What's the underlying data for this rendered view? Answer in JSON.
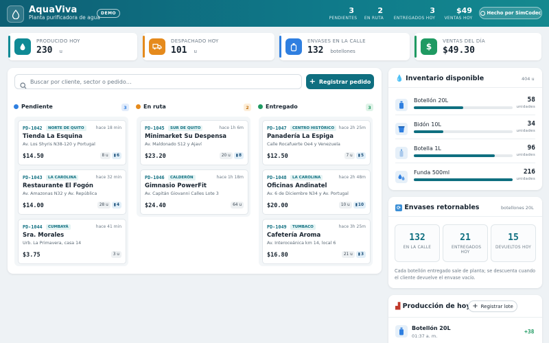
{
  "header": {
    "brand": "AquaViva",
    "subtitle": "Planta purificadora de agua",
    "demo": "DEMO",
    "stats": [
      {
        "value": "3",
        "label": "PENDIENTES"
      },
      {
        "value": "2",
        "label": "EN RUTA"
      },
      {
        "value": "3",
        "label": "ENTREGADOS HOY"
      },
      {
        "value": "$49",
        "label": "VENTAS HOY"
      }
    ],
    "made_by": "Hecho por SimCodec"
  },
  "kpis": [
    {
      "label": "PRODUCIDO HOY",
      "value": "230",
      "unit": "u",
      "color": "#0f8a95"
    },
    {
      "label": "DESPACHADO HOY",
      "value": "101",
      "unit": "u",
      "color": "#e58a1c"
    },
    {
      "label": "ENVASES EN LA CALLE",
      "value": "132",
      "unit": "botellones",
      "color": "#2f7fe0"
    },
    {
      "label": "VENTAS DEL DÍA",
      "value": "$49.30",
      "unit": "",
      "color": "#1f9a62"
    }
  ],
  "search": {
    "placeholder": "Buscar por cliente, sector o pedido…"
  },
  "register_order": "Registrar pedido",
  "columns": [
    {
      "title": "Pendiente",
      "count": "3",
      "dot": "#2f7fe0",
      "cards": [
        {
          "id": "PD-1042",
          "zone": "NORTE DE QUITO",
          "time": "hace 18 min",
          "name": "Tienda La Esquina",
          "address": "Av. Los Shyris N38-120 y Portugal",
          "price": "$14.50",
          "units": "8 u",
          "bottles": "6"
        },
        {
          "id": "PD-1043",
          "zone": "LA CAROLINA",
          "time": "hace 32 min",
          "name": "Restaurante El Fogón",
          "address": "Av. Amazonas N32 y Av. República",
          "price": "$14.00",
          "units": "28 u",
          "bottles": "4"
        },
        {
          "id": "PD-1044",
          "zone": "CUMBAYÁ",
          "time": "hace 41 min",
          "name": "Sra. Morales",
          "address": "Urb. La Primavera, casa 14",
          "price": "$3.75",
          "units": "3 u",
          "bottles": ""
        }
      ]
    },
    {
      "title": "En ruta",
      "count": "2",
      "dot": "#e58a1c",
      "cards": [
        {
          "id": "PD-1045",
          "zone": "SUR DE QUITO",
          "time": "hace 1h 6m",
          "name": "Minimarket Su Despensa",
          "address": "Av. Maldonado S12 y Ajaví",
          "price": "$23.20",
          "units": "20 u",
          "bottles": "8"
        },
        {
          "id": "PD-1046",
          "zone": "CALDERÓN",
          "time": "hace 1h 18m",
          "name": "Gimnasio PowerFit",
          "address": "Av. Capitán Giovanni Calles Lote 3",
          "price": "$24.40",
          "units": "64 u",
          "bottles": ""
        }
      ]
    },
    {
      "title": "Entregado",
      "count": "3",
      "dot": "#1f9a62",
      "cards": [
        {
          "id": "PD-1047",
          "zone": "CENTRO HISTÓRICO",
          "time": "hace 2h 25m",
          "name": "Panadería La Espiga",
          "address": "Calle Rocafuerte Oe4 y Venezuela",
          "price": "$12.50",
          "units": "7 u",
          "bottles": "5"
        },
        {
          "id": "PD-1048",
          "zone": "LA CAROLINA",
          "time": "hace 2h 48m",
          "name": "Oficinas Andinatel",
          "address": "Av. 6 de Diciembre N34 y Av. Portugal",
          "price": "$20.00",
          "units": "10 u",
          "bottles": "10"
        },
        {
          "id": "PD-1049",
          "zone": "TUMBACO",
          "time": "hace 3h 25m",
          "name": "Cafetería Aroma",
          "address": "Av. Interoceánica km 14, local 6",
          "price": "$16.80",
          "units": "21 u",
          "bottles": "3"
        }
      ]
    }
  ],
  "inventory": {
    "title": "Inventario disponible",
    "total": "404 u",
    "items": [
      {
        "name": "Botellón 20L",
        "qty": "58",
        "unit": "unidades",
        "level": 0.5
      },
      {
        "name": "Bidón 10L",
        "qty": "34",
        "unit": "unidades",
        "level": 0.3
      },
      {
        "name": "Botella 1L",
        "qty": "96",
        "unit": "unidades",
        "level": 0.82
      },
      {
        "name": "Funda 500ml",
        "qty": "216",
        "unit": "unidades",
        "level": 1.0
      }
    ]
  },
  "returnables": {
    "title": "Envases retornables",
    "sub": "botellones 20L",
    "boxes": [
      {
        "value": "132",
        "label": "EN LA CALLE"
      },
      {
        "value": "21",
        "label": "ENTREGADOS HOY"
      },
      {
        "value": "15",
        "label": "DEVUELTOS HOY"
      }
    ],
    "note": "Cada botellón entregado sale de planta; se descuenta cuando el cliente devuelve el envase vacío."
  },
  "production": {
    "title": "Producción de hoy",
    "button": "Registrar lote",
    "item": {
      "name": "Botellón 20L",
      "time": "01:37 a. m.",
      "delta": "+38"
    }
  },
  "icons": {
    "logo": "drop-icon",
    "search": "search-icon",
    "plus": "plus-icon",
    "bottle": "bottle-icon"
  }
}
